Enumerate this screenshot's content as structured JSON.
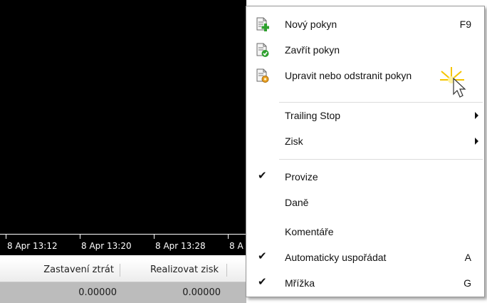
{
  "chart": {
    "time_labels": [
      "8 Apr 13:12",
      "8 Apr 13:20",
      "8 Apr 13:28",
      "8 A"
    ]
  },
  "table": {
    "headers": [
      "Zastavení ztrát",
      "Realizovat zisk"
    ],
    "row": [
      "0.00000",
      "0.00000"
    ]
  },
  "menu": {
    "items": [
      {
        "label": "Nový pokyn",
        "shortcut": "F9",
        "icon": "order-add-icon"
      },
      {
        "label": "Zavřít pokyn",
        "icon": "order-close-icon"
      },
      {
        "label": "Upravit nebo odstranit pokyn",
        "icon": "order-modify-icon"
      },
      {
        "label": "Trailing Stop",
        "submenu": true
      },
      {
        "label": "Zisk",
        "submenu": true
      },
      {
        "label": "Provize",
        "checked": true
      },
      {
        "label": "Daně",
        "checked": false
      },
      {
        "label": "Komentáře",
        "checked": false
      },
      {
        "label": "Automaticky uspořádat",
        "shortcut": "A",
        "checked": true
      },
      {
        "label": "Mřížka",
        "shortcut": "G",
        "checked": true
      }
    ]
  },
  "colors": {
    "chart_background": "#000000",
    "menu_background": "#ffffff",
    "row_background": "#bcbcbc",
    "icon_green": "#2ea02e",
    "icon_orange": "#e8a020"
  }
}
